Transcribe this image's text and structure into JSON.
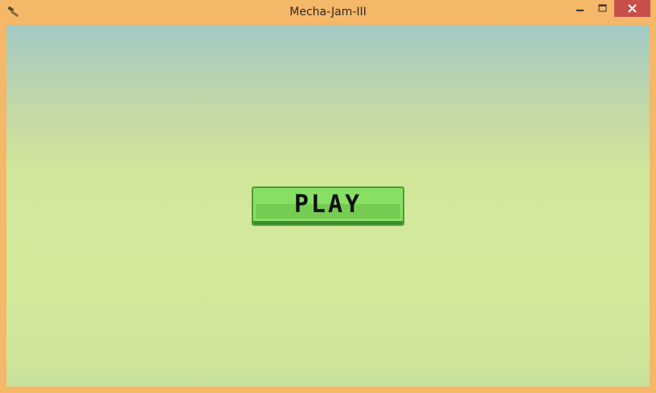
{
  "window": {
    "title": "Mecha-Jam-III",
    "frame_color": "#f5b768",
    "close_color": "#c7504b",
    "icon": "hammer-icon"
  },
  "game": {
    "play_label": "PLAY",
    "button_color": "#87e064"
  }
}
